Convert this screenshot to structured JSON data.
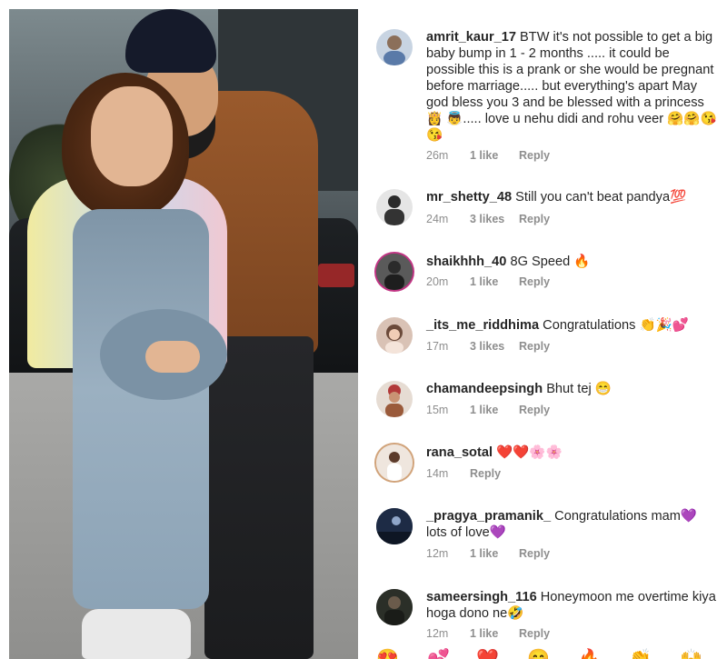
{
  "comments": [
    {
      "username": "amrit_kaur_17",
      "text": "BTW it's not possible to get a big baby bump in 1 - 2 months ..... it could be possible this is a prank or she would be pregnant before marriage..... but everything's apart May god bless you 3 and be blessed with a princess 👸 👼..... love u nehu didi and rohu veer 🤗🤗😘😘",
      "time": "26m",
      "likes": "1 like",
      "reply": "Reply",
      "avatar_color": "#c8d4e2"
    },
    {
      "username": "mr_shetty_48",
      "text": "Still you can't beat pandya💯",
      "time": "24m",
      "likes": "3 likes",
      "reply": "Reply",
      "avatar_color": "#3a3a3a"
    },
    {
      "username": "shaikhhh_40",
      "text": "8G Speed 🔥",
      "time": "20m",
      "likes": "1 like",
      "reply": "Reply",
      "avatar_color": "#2c2c2c"
    },
    {
      "username": "_its_me_riddhima",
      "text": "Congratulations 👏🎉💕",
      "time": "17m",
      "likes": "3 likes",
      "reply": "Reply",
      "avatar_color": "#d9c2b5"
    },
    {
      "username": "chamandeepsingh",
      "text": "Bhut tej 😁",
      "time": "15m",
      "likes": "1 like",
      "reply": "Reply",
      "avatar_color": "#a8663f"
    },
    {
      "username": "rana_sotal",
      "text": "❤️❤️🌸🌸",
      "time": "14m",
      "likes": "",
      "reply": "Reply",
      "avatar_color": "#e8d9cb"
    },
    {
      "username": "_pragya_pramanik_",
      "text": "Congratulations mam💜 lots of love💜",
      "time": "12m",
      "likes": "1 like",
      "reply": "Reply",
      "avatar_color": "#1f2a3a"
    },
    {
      "username": "sameersingh_116",
      "text": "Honeymoon me overtime kiya hoga dono ne🤣",
      "time": "12m",
      "likes": "1 like",
      "reply": "Reply",
      "avatar_color": "#3b3f36"
    }
  ],
  "emoji_bar": [
    "😍",
    "💕",
    "❤️",
    "😊",
    "🔥",
    "👏",
    "🙌"
  ]
}
